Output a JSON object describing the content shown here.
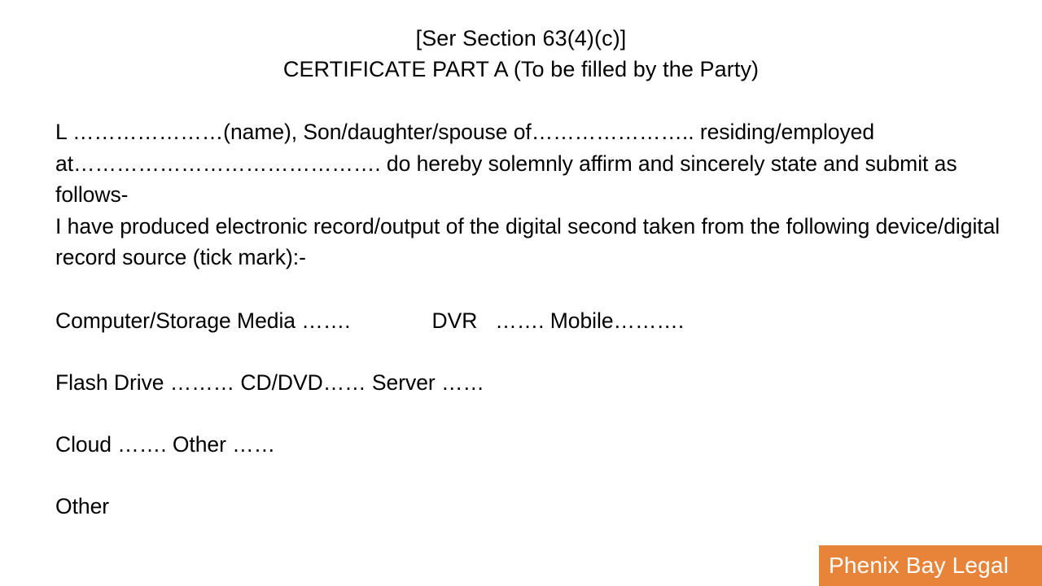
{
  "slide": {
    "background_color": "#FFFFFF",
    "text_color": "#000000"
  },
  "title": {
    "line1": "[Ser Section 63(4)(c)]",
    "line2": "CERTIFICATE PART A (To be filled by the Party)"
  },
  "body": {
    "paragraph1": "L …………………(name), Son/daughter/spouse of………………….. residing/employed at……………………………………. do hereby solemnly affirm and sincerely state and submit as follows-",
    "paragraph2": "I have produced electronic record/output of the digital second taken from the following device/digital record source (tick mark):-"
  },
  "options": {
    "row1_part1": "Computer/Storage Media …….",
    "row1_part2": "DVR   ……. Mobile……….",
    "row2": "Flash Drive ……… CD/DVD…… Server ……",
    "row3": "Cloud ……. Other ……",
    "row4": "Other"
  },
  "footer": {
    "badge_label": "Phenix Bay Legal",
    "badge_background": "#E8833A",
    "badge_text_color": "#FFFFFF"
  }
}
